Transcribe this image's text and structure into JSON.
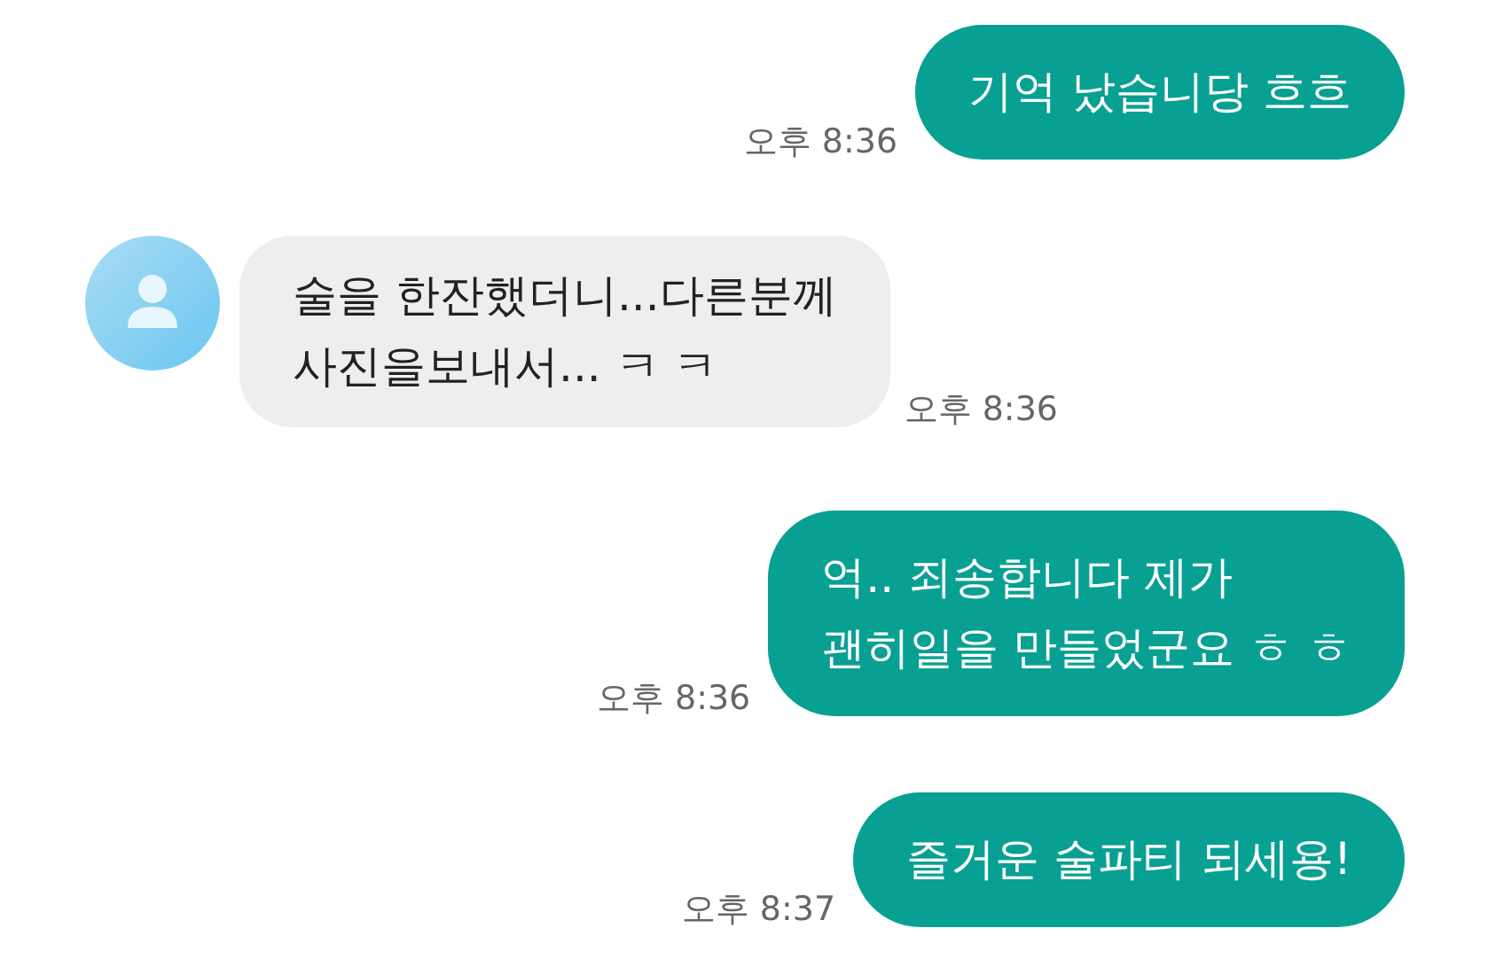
{
  "messages": [
    {
      "kind": "sent",
      "lines": [
        "기억 났습니당 흐흐"
      ],
      "time": "오후 8:36"
    },
    {
      "kind": "received",
      "lines": [
        "술을 한잔했더니...다른분께",
        "사진을보내서... ㅋ ㅋ"
      ],
      "time": "오후 8:36"
    },
    {
      "kind": "sent",
      "lines": [
        "억.. 죄송합니다 제가",
        "괜히일을 만들었군요 ㅎ ㅎ"
      ],
      "time": "오후 8:36"
    },
    {
      "kind": "sent",
      "lines": [
        "즐거운 술파티 되세용!"
      ],
      "time": "오후 8:37"
    }
  ]
}
